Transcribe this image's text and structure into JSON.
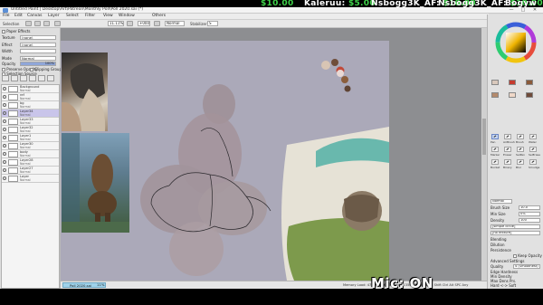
{
  "stream_overlay": {
    "tickers": [
      {
        "name": "",
        "amount": "$10.00"
      },
      {
        "name": "Kaleruu:",
        "amount": "$5.00"
      },
      {
        "name": "Nsbogg3K_AF:",
        "amount": "$10.00"
      },
      {
        "name": "Nsbogg3K_AF:",
        "amount": "$10.00"
      },
      {
        "name": "Bogyw",
        "amount": ""
      }
    ],
    "mic_status": "Mic: ON"
  },
  "window": {
    "title": "Untitled Paint | Desktop\\Art\\Patreon\\Monthly Poll\\Poll 2020.sai (*)",
    "controls": [
      "—",
      "□",
      "✕"
    ]
  },
  "menubar": {
    "items": [
      "File",
      "Edit",
      "Canvas",
      "Layer",
      "Select",
      "Filter",
      "View",
      "Window",
      "Others"
    ]
  },
  "toolbar": {
    "selection_label": "Selection",
    "zoom_value": "11.11%",
    "rotate_value": "+000°",
    "mode_value": "Normal",
    "stabilizer_label": "Stabilizer",
    "stabilizer_value": "S"
  },
  "left_panel": {
    "effect_header": "Paper Effects",
    "texture_label": "Texture",
    "texture_value": "(none)",
    "effect_label": "Effect",
    "effect_value": "(none)",
    "width_label": "Width",
    "mode_label": "Mode",
    "mode_value": "Normal",
    "opacity_label": "Opacity",
    "opacity_value": "100%",
    "opacity_level": 1.0,
    "checkboxes": [
      "Preserve Opacity",
      "Clipping Group",
      "Selection Source"
    ],
    "layers": [
      {
        "name": "Background",
        "blend": "Normal",
        "selected": false
      },
      {
        "name": "ref",
        "blend": "Normal",
        "selected": false
      },
      {
        "name": "bg",
        "blend": "Normal",
        "selected": false
      },
      {
        "name": "Layer34",
        "blend": "Normal",
        "selected": true
      },
      {
        "name": "Layer33",
        "blend": "Normal",
        "selected": false
      },
      {
        "name": "Layer32",
        "blend": "Normal",
        "selected": false
      },
      {
        "name": "Layer1",
        "blend": "Normal",
        "selected": false
      },
      {
        "name": "Layer30",
        "blend": "Normal",
        "selected": false
      },
      {
        "name": "body",
        "blend": "Normal",
        "selected": false
      },
      {
        "name": "Layer28",
        "blend": "Normal",
        "selected": false
      },
      {
        "name": "Layer27",
        "blend": "Normal",
        "selected": false
      },
      {
        "name": "Layer",
        "blend": "Normal",
        "selected": false
      }
    ]
  },
  "status_bar": {
    "tab_name": "Poll 2020.sai",
    "tab_zoom": "11%",
    "memory": "Memory Load: 47% (175.6MB used / 1356MB reserved)    Shift  Ctrl  Alt  SPC  Any"
  },
  "right_panel": {
    "swatches": [
      "#d9c8bc",
      "#c53b2f",
      "#8a5a3a",
      "#b48a6c",
      "#f0d8c8",
      "#6f4b3a"
    ],
    "tools": [
      {
        "label": "Pen",
        "selected": true
      },
      {
        "label": "AirBrush",
        "selected": false
      },
      {
        "label": "Brush",
        "selected": false
      },
      {
        "label": "Water",
        "selected": false
      },
      {
        "label": "Marker",
        "selected": false
      },
      {
        "label": "Eraser",
        "selected": false
      },
      {
        "label": "SelPen",
        "selected": false
      },
      {
        "label": "SelErase",
        "selected": false
      },
      {
        "label": "Bucket",
        "selected": false
      },
      {
        "label": "Binary",
        "selected": false
      },
      {
        "label": "Blur",
        "selected": false
      },
      {
        "label": "Smudge",
        "selected": false
      }
    ],
    "brush_mode_label": "Normal",
    "size_label": "Brush Size",
    "size_value": "10.0",
    "min_size_label": "Min Size",
    "min_size_value": "0%",
    "density_label": "Density",
    "density_value": "100",
    "shape_value": "[simple circle]",
    "texture_value": "[no texture]",
    "blending_label": "Blending",
    "dilution_label": "Dilution",
    "persistence_label": "Persistence",
    "keep_opacity_label": "Keep Opacity",
    "advanced_label": "Advanced Settings",
    "quality_label": "Quality",
    "quality_value": "4 (Smoothest)",
    "edge_label": "Edge Hardness",
    "min_density_label": "Min Density",
    "max_dens_label": "Max Dens Prs.",
    "hard_soft_label": "Hard <-> Soft",
    "press_label": "Press:",
    "press_opts": "Dens  Size  Blend"
  }
}
